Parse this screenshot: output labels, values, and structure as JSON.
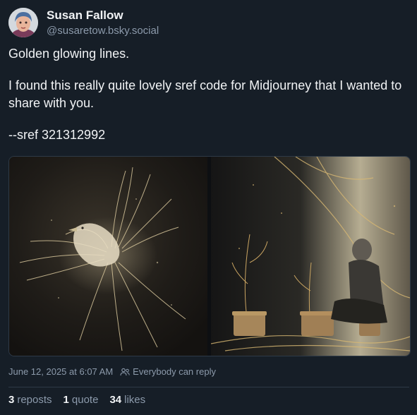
{
  "author": {
    "name": "Susan Fallow",
    "handle": "@susaretow.bsky.social"
  },
  "post": {
    "lines": [
      "Golden glowing lines.",
      "I found this really quite lovely sref code for Midjourney that I wanted to share with you.",
      "--sref 321312992"
    ]
  },
  "meta": {
    "timestamp": "June 12, 2025 at 6:07 AM",
    "reply_setting": "Everybody can reply",
    "reply_icon": "people-icon"
  },
  "stats": {
    "reposts_count": "3",
    "reposts_label": "reposts",
    "quote_count": "1",
    "quote_label": "quote",
    "likes_count": "34",
    "likes_label": "likes"
  },
  "colors": {
    "background": "#161e27",
    "text_primary": "#f1f3f5",
    "text_secondary": "#8c9aab",
    "gold": "#d8b873"
  }
}
